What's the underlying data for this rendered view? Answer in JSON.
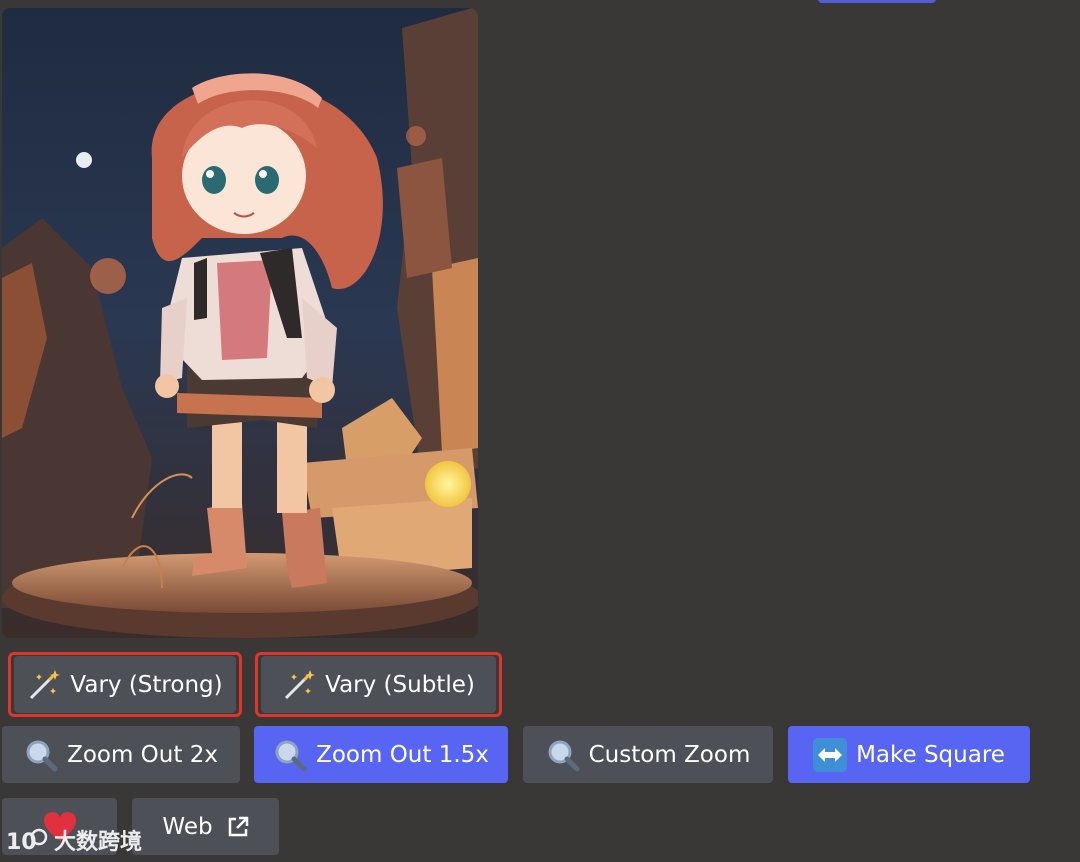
{
  "buttons": {
    "vary_strong": {
      "label": "Vary (Strong)",
      "icon": "magic-wand-icon"
    },
    "vary_subtle": {
      "label": "Vary (Subtle)",
      "icon": "magic-wand-icon"
    },
    "zoom_out_2x": {
      "label": "Zoom Out 2x",
      "icon": "magnifier-icon"
    },
    "zoom_out_1_5x": {
      "label": "Zoom Out 1.5x",
      "icon": "magnifier-icon"
    },
    "custom_zoom": {
      "label": "Custom Zoom",
      "icon": "magnifier-icon"
    },
    "make_square": {
      "label": "Make Square",
      "icon": "left-right-arrow-icon"
    },
    "favorite": {
      "icon": "heart-icon"
    },
    "web": {
      "label": "Web",
      "icon": "external-link-icon"
    }
  },
  "watermark": {
    "text": "大数跨境"
  },
  "colors": {
    "background": "#393836",
    "button_gray": "#4e5058",
    "button_blue": "#5865f2",
    "highlight": "#e0352b"
  }
}
